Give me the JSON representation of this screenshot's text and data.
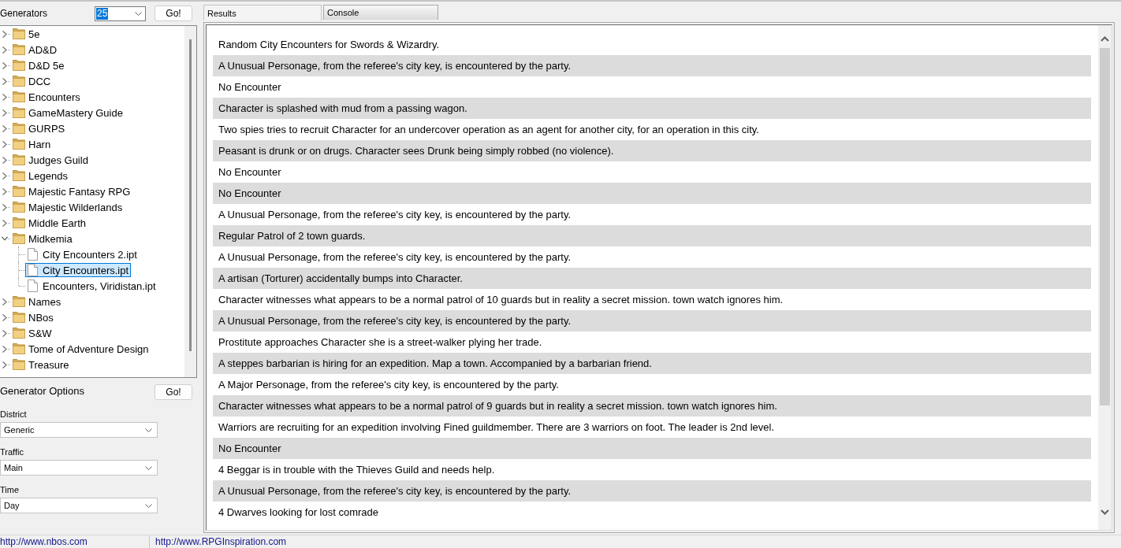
{
  "generators": {
    "label": "Generators",
    "count_select": {
      "value": "25",
      "focused": true
    },
    "go_button": "Go!",
    "tree": [
      {
        "kind": "folder",
        "label": "5e",
        "expanded": false,
        "selected": false
      },
      {
        "kind": "folder",
        "label": "AD&D",
        "expanded": false,
        "selected": false
      },
      {
        "kind": "folder",
        "label": "D&D 5e",
        "expanded": false,
        "selected": false
      },
      {
        "kind": "folder",
        "label": "DCC",
        "expanded": false,
        "selected": false
      },
      {
        "kind": "folder",
        "label": "Encounters",
        "expanded": false,
        "selected": false
      },
      {
        "kind": "folder",
        "label": "GameMastery Guide",
        "expanded": false,
        "selected": false
      },
      {
        "kind": "folder",
        "label": "GURPS",
        "expanded": false,
        "selected": false
      },
      {
        "kind": "folder",
        "label": "Harn",
        "expanded": false,
        "selected": false
      },
      {
        "kind": "folder",
        "label": "Judges Guild",
        "expanded": false,
        "selected": false
      },
      {
        "kind": "folder",
        "label": "Legends",
        "expanded": false,
        "selected": false
      },
      {
        "kind": "folder",
        "label": "Majestic Fantasy RPG",
        "expanded": false,
        "selected": false
      },
      {
        "kind": "folder",
        "label": "Majestic Wilderlands",
        "expanded": false,
        "selected": false
      },
      {
        "kind": "folder",
        "label": "Middle Earth",
        "expanded": false,
        "selected": false
      },
      {
        "kind": "folder",
        "label": "Midkemia",
        "expanded": true,
        "selected": false,
        "children": [
          {
            "kind": "file",
            "label": "City Encounters 2.ipt",
            "selected": false
          },
          {
            "kind": "file",
            "label": "City Encounters.ipt",
            "selected": true
          },
          {
            "kind": "file",
            "label": "Encounters, Viridistan.ipt",
            "selected": false
          }
        ]
      },
      {
        "kind": "folder",
        "label": "Names",
        "expanded": false,
        "selected": false
      },
      {
        "kind": "folder",
        "label": "NBos",
        "expanded": false,
        "selected": false
      },
      {
        "kind": "folder",
        "label": "S&W",
        "expanded": false,
        "selected": false
      },
      {
        "kind": "folder",
        "label": "Tome of Adventure Design",
        "expanded": false,
        "selected": false
      },
      {
        "kind": "folder",
        "label": "Treasure",
        "expanded": false,
        "selected": false
      }
    ]
  },
  "generator_options": {
    "title": "Generator Options",
    "go_button": "Go!",
    "fields": [
      {
        "label": "District",
        "value": "Generic"
      },
      {
        "label": "Traffic",
        "value": "Main"
      },
      {
        "label": "Time",
        "value": "Day"
      }
    ]
  },
  "tabs": [
    {
      "label": "Results",
      "selected": true
    },
    {
      "label": "Console",
      "selected": false
    }
  ],
  "results": [
    "Random City Encounters for Swords & Wizardry.",
    "A Unusual Personage, from the referee's city key, is encountered by the party.",
    "No Encounter",
    "Character is splashed with mud from a passing wagon.",
    "Two spies tries to recruit Character for an undercover operation as an agent for another city, for an operation in this city.",
    "Peasant is drunk or on drugs. Character sees Drunk being simply robbed (no violence).",
    "No Encounter",
    "No Encounter",
    "A Unusual Personage, from the referee's city key, is encountered by the party.",
    "Regular Patrol of 2 town guards.",
    "A Unusual Personage, from the referee's city key, is encountered by the party.",
    "A artisan (Torturer) accidentally bumps into Character.",
    "Character witnesses what appears to be a normal patrol of 10 guards but in reality a secret mission. town watch ignores him.",
    "A Unusual Personage, from the referee's city key, is encountered by the party.",
    "Prostitute approaches Character she is a street-walker plying her trade.",
    "A steppes barbarian is hiring for an expedition. Map a town. Accompanied by a barbarian friend.",
    "A Major Personage, from the referee's city key, is encountered by the party.",
    "Character witnesses what appears to be a normal patrol of 9 guards but in reality a secret mission. town watch ignores him.",
    "Warriors are recruiting for an expedition involving Fined guildmember. There are 3 warriors on foot. The leader is 2nd level.",
    "No Encounter",
    "4 Beggar is in trouble with the Thieves Guild and needs help.",
    "A Unusual Personage, from the referee's city key, is encountered by the party.",
    "4 Dwarves looking for lost comrade"
  ],
  "status_bar": [
    "http://www.nbos.com",
    "http://www.RPGInspiration.com"
  ]
}
